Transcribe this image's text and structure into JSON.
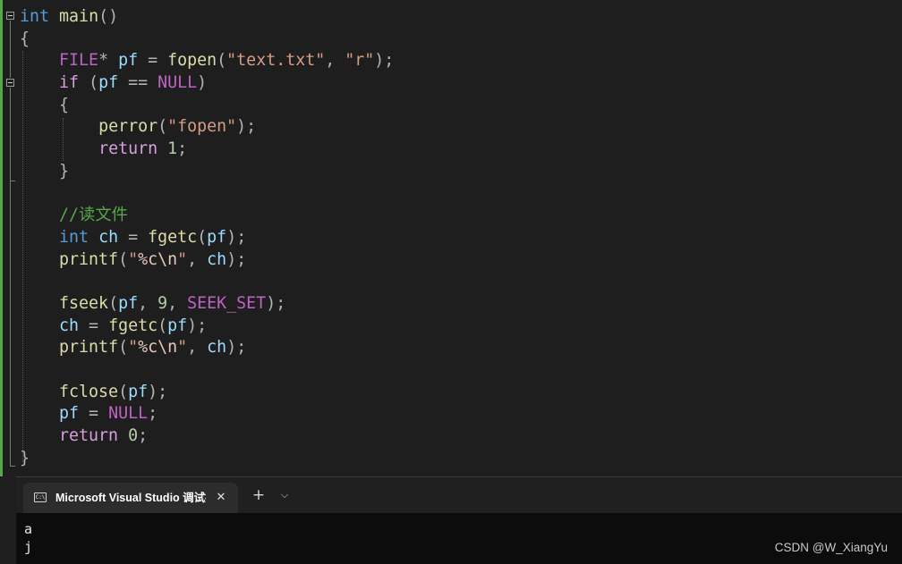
{
  "editor": {
    "lines": [
      [
        {
          "t": "int",
          "c": "kw"
        },
        {
          "t": " "
        },
        {
          "t": "main",
          "c": "fn"
        },
        {
          "t": "()",
          "c": "punc"
        }
      ],
      [
        {
          "t": "{",
          "c": "punc"
        }
      ],
      [
        {
          "t": "    "
        },
        {
          "t": "FILE",
          "c": "macro"
        },
        {
          "t": "* ",
          "c": "punc"
        },
        {
          "t": "pf",
          "c": "var"
        },
        {
          "t": " = ",
          "c": "punc"
        },
        {
          "t": "fopen",
          "c": "fn"
        },
        {
          "t": "(",
          "c": "punc"
        },
        {
          "t": "\"text.txt\"",
          "c": "str"
        },
        {
          "t": ", ",
          "c": "punc"
        },
        {
          "t": "\"r\"",
          "c": "str"
        },
        {
          "t": ");",
          "c": "punc"
        }
      ],
      [
        {
          "t": "    "
        },
        {
          "t": "if",
          "c": "ctl"
        },
        {
          "t": " (",
          "c": "punc"
        },
        {
          "t": "pf",
          "c": "var"
        },
        {
          "t": " == ",
          "c": "punc"
        },
        {
          "t": "NULL",
          "c": "macro"
        },
        {
          "t": ")",
          "c": "punc"
        }
      ],
      [
        {
          "t": "    "
        },
        {
          "t": "{",
          "c": "punc"
        }
      ],
      [
        {
          "t": "        "
        },
        {
          "t": "perror",
          "c": "fn"
        },
        {
          "t": "(",
          "c": "punc"
        },
        {
          "t": "\"fopen\"",
          "c": "str"
        },
        {
          "t": ");",
          "c": "punc"
        }
      ],
      [
        {
          "t": "        "
        },
        {
          "t": "return",
          "c": "ctl"
        },
        {
          "t": " "
        },
        {
          "t": "1",
          "c": "num"
        },
        {
          "t": ";",
          "c": "punc"
        }
      ],
      [
        {
          "t": "    "
        },
        {
          "t": "}",
          "c": "punc"
        }
      ],
      [],
      [
        {
          "t": "    "
        },
        {
          "t": "//读文件",
          "c": "cmt"
        }
      ],
      [
        {
          "t": "    "
        },
        {
          "t": "int",
          "c": "kw"
        },
        {
          "t": " "
        },
        {
          "t": "ch",
          "c": "var"
        },
        {
          "t": " = ",
          "c": "punc"
        },
        {
          "t": "fgetc",
          "c": "fn"
        },
        {
          "t": "(",
          "c": "punc"
        },
        {
          "t": "pf",
          "c": "var"
        },
        {
          "t": ");",
          "c": "punc"
        }
      ],
      [
        {
          "t": "    "
        },
        {
          "t": "printf",
          "c": "fn"
        },
        {
          "t": "(",
          "c": "punc"
        },
        {
          "t": "\"",
          "c": "str"
        },
        {
          "t": "%c",
          "c": "esc"
        },
        {
          "t": "\\n",
          "c": "esc"
        },
        {
          "t": "\"",
          "c": "str"
        },
        {
          "t": ", ",
          "c": "punc"
        },
        {
          "t": "ch",
          "c": "var"
        },
        {
          "t": ");",
          "c": "punc"
        }
      ],
      [],
      [
        {
          "t": "    "
        },
        {
          "t": "fseek",
          "c": "fn"
        },
        {
          "t": "(",
          "c": "punc"
        },
        {
          "t": "pf",
          "c": "var"
        },
        {
          "t": ", ",
          "c": "punc"
        },
        {
          "t": "9",
          "c": "num"
        },
        {
          "t": ", ",
          "c": "punc"
        },
        {
          "t": "SEEK_SET",
          "c": "macro"
        },
        {
          "t": ");",
          "c": "punc"
        }
      ],
      [
        {
          "t": "    "
        },
        {
          "t": "ch",
          "c": "var"
        },
        {
          "t": " = ",
          "c": "punc"
        },
        {
          "t": "fgetc",
          "c": "fn"
        },
        {
          "t": "(",
          "c": "punc"
        },
        {
          "t": "pf",
          "c": "var"
        },
        {
          "t": ");",
          "c": "punc"
        }
      ],
      [
        {
          "t": "    "
        },
        {
          "t": "printf",
          "c": "fn"
        },
        {
          "t": "(",
          "c": "punc"
        },
        {
          "t": "\"",
          "c": "str"
        },
        {
          "t": "%c",
          "c": "esc"
        },
        {
          "t": "\\n",
          "c": "esc"
        },
        {
          "t": "\"",
          "c": "str"
        },
        {
          "t": ", ",
          "c": "punc"
        },
        {
          "t": "ch",
          "c": "var"
        },
        {
          "t": ");",
          "c": "punc"
        }
      ],
      [],
      [
        {
          "t": "    "
        },
        {
          "t": "fclose",
          "c": "fn"
        },
        {
          "t": "(",
          "c": "punc"
        },
        {
          "t": "pf",
          "c": "var"
        },
        {
          "t": ");",
          "c": "punc"
        }
      ],
      [
        {
          "t": "    "
        },
        {
          "t": "pf",
          "c": "var"
        },
        {
          "t": " = ",
          "c": "punc"
        },
        {
          "t": "NULL",
          "c": "macro"
        },
        {
          "t": ";",
          "c": "punc"
        }
      ],
      [
        {
          "t": "    "
        },
        {
          "t": "return",
          "c": "ctl"
        },
        {
          "t": " "
        },
        {
          "t": "0",
          "c": "num"
        },
        {
          "t": ";",
          "c": "punc"
        }
      ],
      [
        {
          "t": "}",
          "c": "punc"
        }
      ]
    ]
  },
  "terminal": {
    "tab_icon": "C:\\",
    "tab_title": "Microsoft Visual Studio 调试控制台",
    "close_glyph": "✕",
    "new_tab_glyph": "+",
    "dropdown_glyph": "⌵",
    "output": [
      "a",
      "j"
    ]
  },
  "watermark": "CSDN @W_XiangYu",
  "colors": {
    "editor_bg": "#1e1e1e",
    "terminal_bg": "#0c0c0c",
    "change_bar": "#57a64a"
  }
}
